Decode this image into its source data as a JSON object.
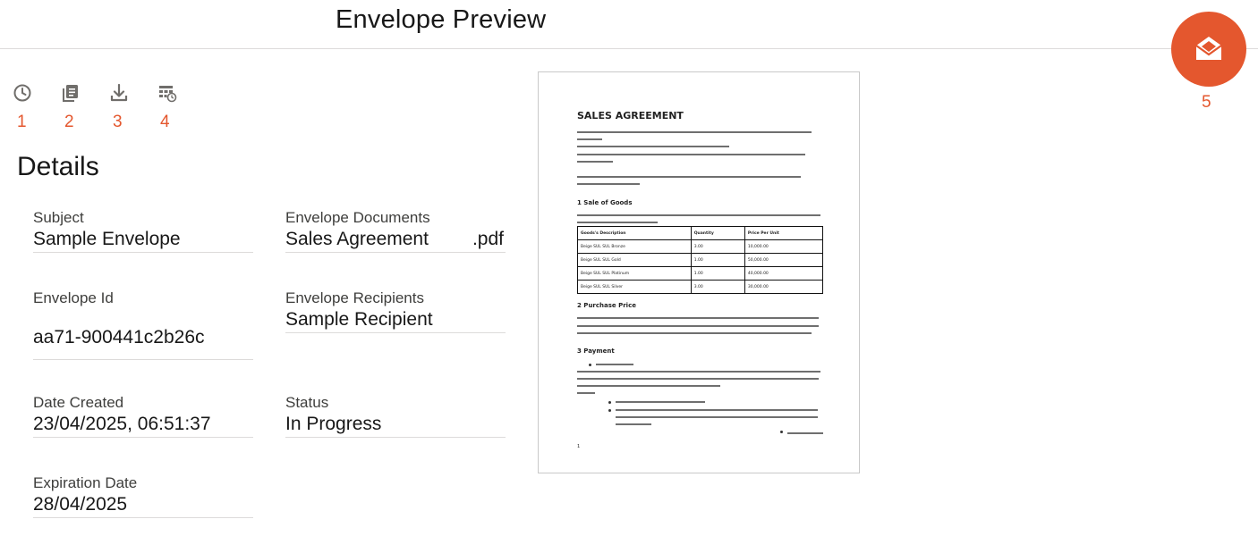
{
  "header": {
    "title": "Envelope Preview"
  },
  "toolbar": {
    "items": [
      {
        "icon": "history-icon",
        "number": "1"
      },
      {
        "icon": "copy-documents-icon",
        "number": "2"
      },
      {
        "icon": "download-icon",
        "number": "3"
      },
      {
        "icon": "table-schedule-icon",
        "number": "4"
      }
    ]
  },
  "fab": {
    "icon": "envelope-open-icon",
    "number": "5",
    "color": "#e4572e"
  },
  "details": {
    "heading": "Details",
    "subject": {
      "label": "Subject",
      "value": "Sample Envelope"
    },
    "documents": {
      "label": "Envelope Documents",
      "value": "Sales Agreement",
      "extension": ".pdf"
    },
    "envelope_id": {
      "label": "Envelope Id",
      "value": "aa71-900441c2b26c"
    },
    "recipients": {
      "label": "Envelope Recipients",
      "value": "Sample Recipient"
    },
    "date_created": {
      "label": "Date Created",
      "value": "23/04/2025, 06:51:37"
    },
    "status": {
      "label": "Status",
      "value": "In Progress"
    },
    "expiration": {
      "label": "Expiration Date",
      "value": "28/04/2025"
    }
  },
  "preview": {
    "title": "SALES AGREEMENT",
    "section1": "1 Sale of Goods",
    "section2": "2 Purchase Price",
    "section3": "3 Payment",
    "table": {
      "headers": [
        "Goods's Description",
        "Quantity",
        "Price Per Unit"
      ],
      "rows": [
        [
          "Beige SUL SUL Bronze",
          "3.00",
          "10,000.00"
        ],
        [
          "Beige SUL SUL Gold",
          "1.00",
          "50,000.00"
        ],
        [
          "Beige SUL SUL Platinum",
          "1.00",
          "40,000.00"
        ],
        [
          "Beige SUL SUL Silver",
          "3.00",
          "30,000.00"
        ]
      ]
    },
    "page_number": "1"
  }
}
